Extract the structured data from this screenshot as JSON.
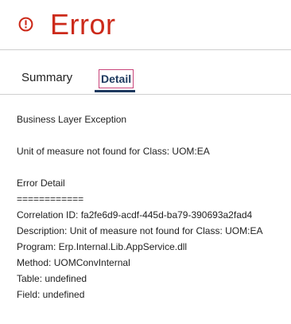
{
  "header": {
    "icon": "error-circle-icon",
    "title": "Error",
    "accent_color": "#cc2a1a"
  },
  "tabs": [
    {
      "label": "Summary",
      "selected": false
    },
    {
      "label": "Detail",
      "selected": true
    }
  ],
  "detail": {
    "exception_type": "Business Layer Exception",
    "message": "Unit of measure not found for Class: UOM:EA",
    "section_title": "Error Detail",
    "separator": "============",
    "correlation_id": "Correlation ID: fa2fe6d9-acdf-445d-ba79-390693a2fad4",
    "description": "Description: Unit of measure not found for Class: UOM:EA",
    "program": "Program: Erp.Internal.Lib.AppService.dll",
    "method": "Method: UOMConvInternal",
    "table": "Table: undefined",
    "field": "Field: undefined"
  }
}
